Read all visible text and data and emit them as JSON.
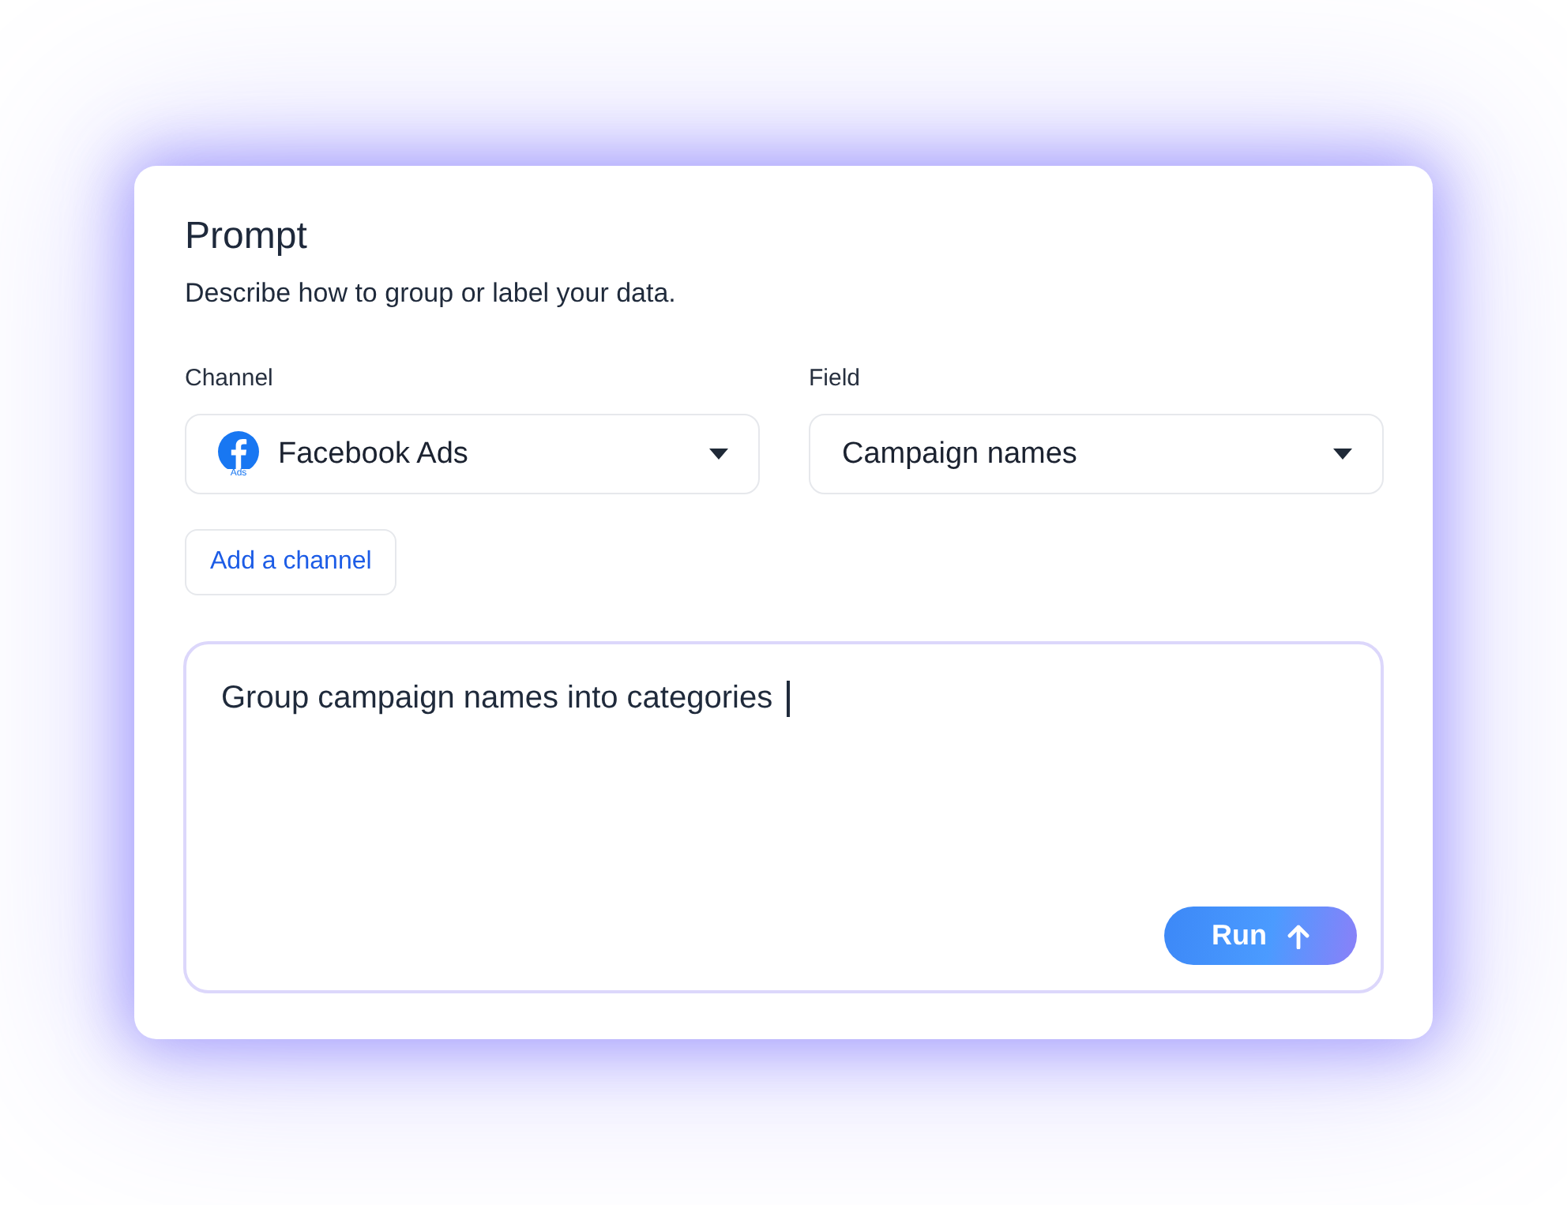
{
  "header": {
    "title": "Prompt",
    "description": "Describe how to group or label your data."
  },
  "selects": [
    {
      "kind": "logo",
      "label": "Channel",
      "value": "Facebook Ads",
      "logo_caption": "Ads"
    },
    {
      "kind": "plain",
      "label": "Field",
      "value": "Campaign names"
    }
  ],
  "add_button": "Add a channel",
  "prompt_input": {
    "value": "Group campaign names into categories",
    "focused": true
  },
  "run_button": "Run"
}
